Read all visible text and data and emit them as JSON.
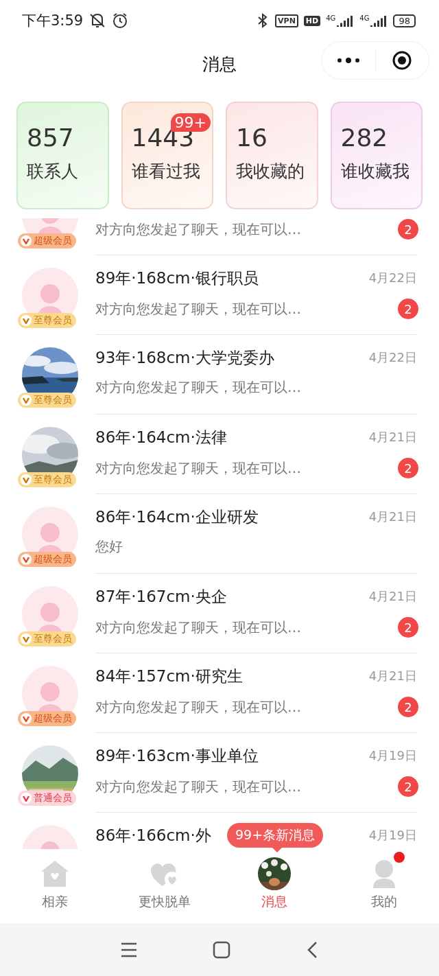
{
  "status_bar": {
    "time": "下午3:59",
    "vpn": "VPN",
    "hd": "HD",
    "networks": [
      "4G",
      "4G"
    ],
    "battery": "98"
  },
  "header": {
    "title": "消息"
  },
  "stats": [
    {
      "count": "857",
      "label": "联系人",
      "color": "#dff5dc"
    },
    {
      "count": "1443",
      "label": "谁看过我",
      "color": "#fde8dc",
      "badge": "99+"
    },
    {
      "count": "16",
      "label": "我收藏的",
      "color": "#fde6e6"
    },
    {
      "count": "282",
      "label": "谁收藏我",
      "color": "#f9e3f4"
    }
  ],
  "conversations": [
    {
      "message": "对方向您发起了聊天，现在可以…",
      "unread": "2",
      "avatar": {
        "kind": "placeholder"
      },
      "tier": {
        "kind": "super",
        "label": "超级会员"
      }
    },
    {
      "title": "89年·168cm·银行职员",
      "date": "4月22日",
      "message": "对方向您发起了聊天，现在可以…",
      "unread": "2",
      "avatar": {
        "kind": "placeholder"
      },
      "tier": {
        "kind": "supreme",
        "label": "至尊会员"
      }
    },
    {
      "title": "93年·168cm·大学党委办",
      "date": "4月22日",
      "message": "对方向您发起了聊天，现在可以…",
      "tier": {
        "kind": "supreme",
        "label": "至尊会员"
      }
    },
    {
      "title": "86年·164cm·法律",
      "date": "4月21日",
      "message": "对方向您发起了聊天，现在可以…",
      "unread": "2",
      "tier": {
        "kind": "supreme",
        "label": "至尊会员"
      }
    },
    {
      "title": "86年·164cm·企业研发",
      "date": "4月21日",
      "message": "您好",
      "avatar": {
        "kind": "placeholder"
      },
      "tier": {
        "kind": "super",
        "label": "超级会员"
      }
    },
    {
      "title": "87年·167cm·央企",
      "date": "4月21日",
      "message": "对方向您发起了聊天，现在可以…",
      "unread": "2",
      "avatar": {
        "kind": "placeholder"
      },
      "tier": {
        "kind": "supreme",
        "label": "至尊会员"
      }
    },
    {
      "title": "84年·157cm·研究生",
      "date": "4月21日",
      "message": "对方向您发起了聊天，现在可以…",
      "unread": "2",
      "avatar": {
        "kind": "placeholder"
      },
      "tier": {
        "kind": "super",
        "label": "超级会员"
      }
    },
    {
      "title": "89年·163cm·事业单位",
      "date": "4月19日",
      "message": "对方向您发起了聊天，现在可以…",
      "unread": "2",
      "tier": {
        "kind": "regular",
        "label": "普通会员"
      }
    },
    {
      "title": "86年·166cm·外",
      "date": "4月19日",
      "avatar": {
        "kind": "placeholder"
      }
    }
  ],
  "new_messages_tip": "99+条新消息",
  "tabs": [
    {
      "label": "相亲",
      "selected": false,
      "dot": false
    },
    {
      "label": "更快脱单",
      "selected": false,
      "dot": false
    },
    {
      "label": "消息",
      "selected": true,
      "dot": false
    },
    {
      "label": "我的",
      "selected": false,
      "dot": true
    }
  ]
}
